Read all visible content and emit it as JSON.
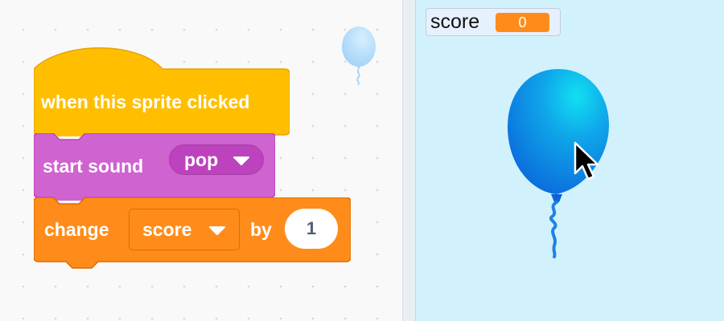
{
  "code_area": {
    "hat_block": {
      "label": "when this sprite clicked",
      "color": "#ffbf00"
    },
    "sound_block": {
      "label": "start sound",
      "sound": "pop",
      "color": "#cf63cf"
    },
    "variable_block": {
      "label_change": "change",
      "variable": "score",
      "label_by": "by",
      "amount": "1",
      "color": "#ff8c1a"
    },
    "sprite_thumbnail": "balloon"
  },
  "stage": {
    "monitor": {
      "label": "score",
      "value": "0"
    },
    "sprite": "balloon",
    "cursor": "arrow-pointer",
    "background_color": "#d1f2fc"
  }
}
